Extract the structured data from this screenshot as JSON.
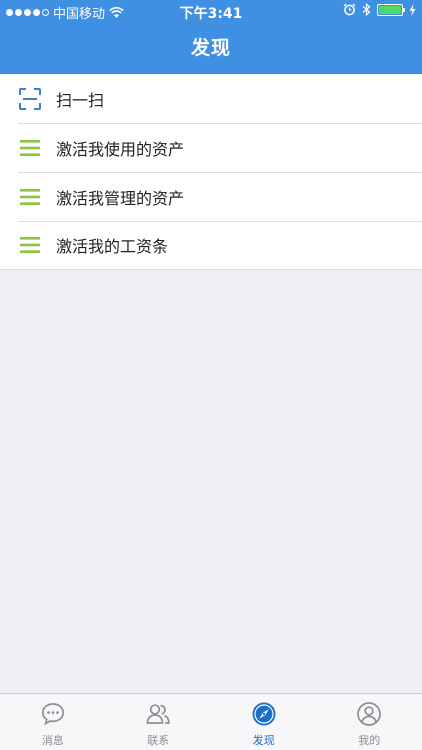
{
  "status_bar": {
    "carrier": "中国移动",
    "time": "下午3:41"
  },
  "nav": {
    "title": "发现"
  },
  "menu": {
    "items": [
      {
        "label": "扫一扫",
        "icon": "scan-icon"
      },
      {
        "label": "激活我使用的资产",
        "icon": "list-icon"
      },
      {
        "label": "激活我管理的资产",
        "icon": "list-icon"
      },
      {
        "label": "激活我的工资条",
        "icon": "list-icon"
      }
    ]
  },
  "tabbar": {
    "tabs": [
      {
        "label": "消息",
        "icon": "chat-bubble-icon",
        "active": false
      },
      {
        "label": "联系",
        "icon": "contacts-icon",
        "active": false
      },
      {
        "label": "发现",
        "icon": "compass-icon",
        "active": true
      },
      {
        "label": "我的",
        "icon": "profile-icon",
        "active": false
      }
    ]
  },
  "colors": {
    "header_bg": "#3f8fe3",
    "list_icon": "#8cc63f",
    "scan_icon": "#3b7fc4",
    "tab_active": "#1a6fc9",
    "tab_inactive": "#8e8e93"
  }
}
